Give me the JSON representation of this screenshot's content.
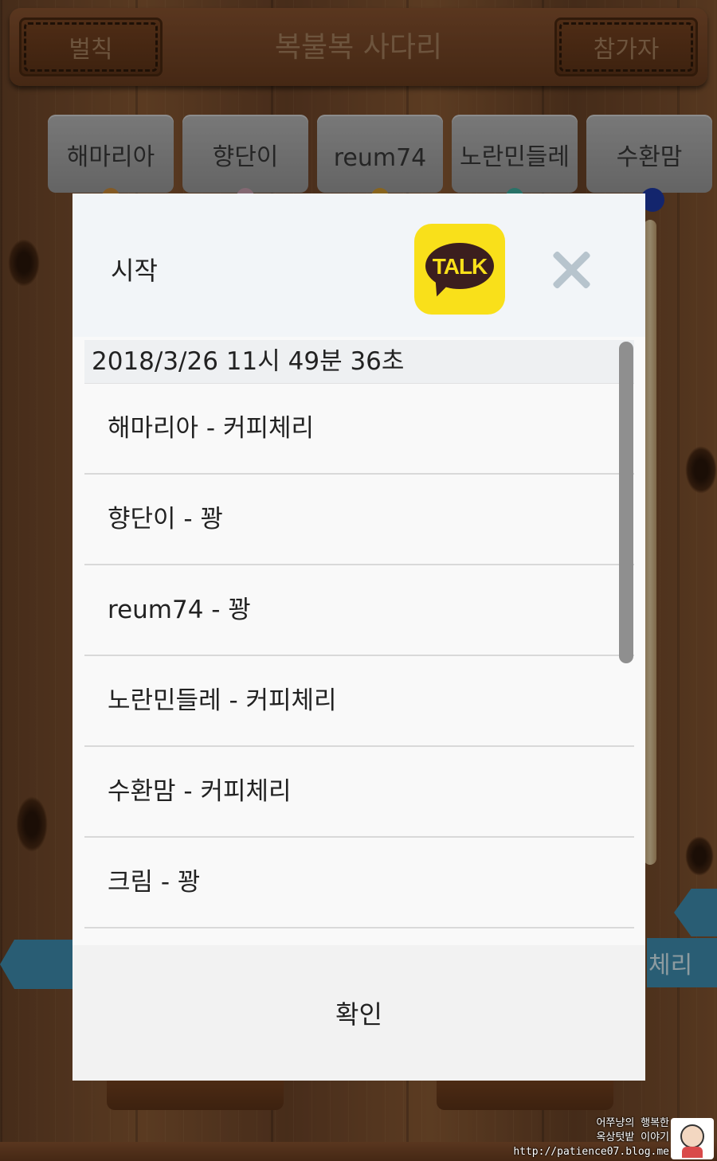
{
  "app": {
    "rules_button": "벌칙",
    "title": "복불복 사다리",
    "participants_button": "참가자"
  },
  "players": [
    {
      "name": "해마리아",
      "color": "#c98a3a"
    },
    {
      "name": "향단이",
      "color": "#c9a0b0"
    },
    {
      "name": "reum74",
      "color": "#d19a2e"
    },
    {
      "name": "노란민들레",
      "color": "#3fb0a0"
    },
    {
      "name": "수환맘",
      "color": "#1e3aa8"
    }
  ],
  "background": {
    "result_tag_right": "체리"
  },
  "dialog": {
    "title": "시작",
    "share_icon_text": "TALK",
    "timestamp": "2018/3/26  11시 49분 36초",
    "results": [
      "해마리아 - 커피체리",
      "향단이 - 꽝",
      "reum74 - 꽝",
      "노란민들레 - 커피체리",
      "수환맘 - 커피체리",
      "크림 - 꽝"
    ],
    "confirm_button": "확인"
  },
  "watermark": {
    "line1": "어쭈냥의 행복한",
    "line2": "옥상텃밭 이야기",
    "line3": "http://patience07.blog.me"
  }
}
